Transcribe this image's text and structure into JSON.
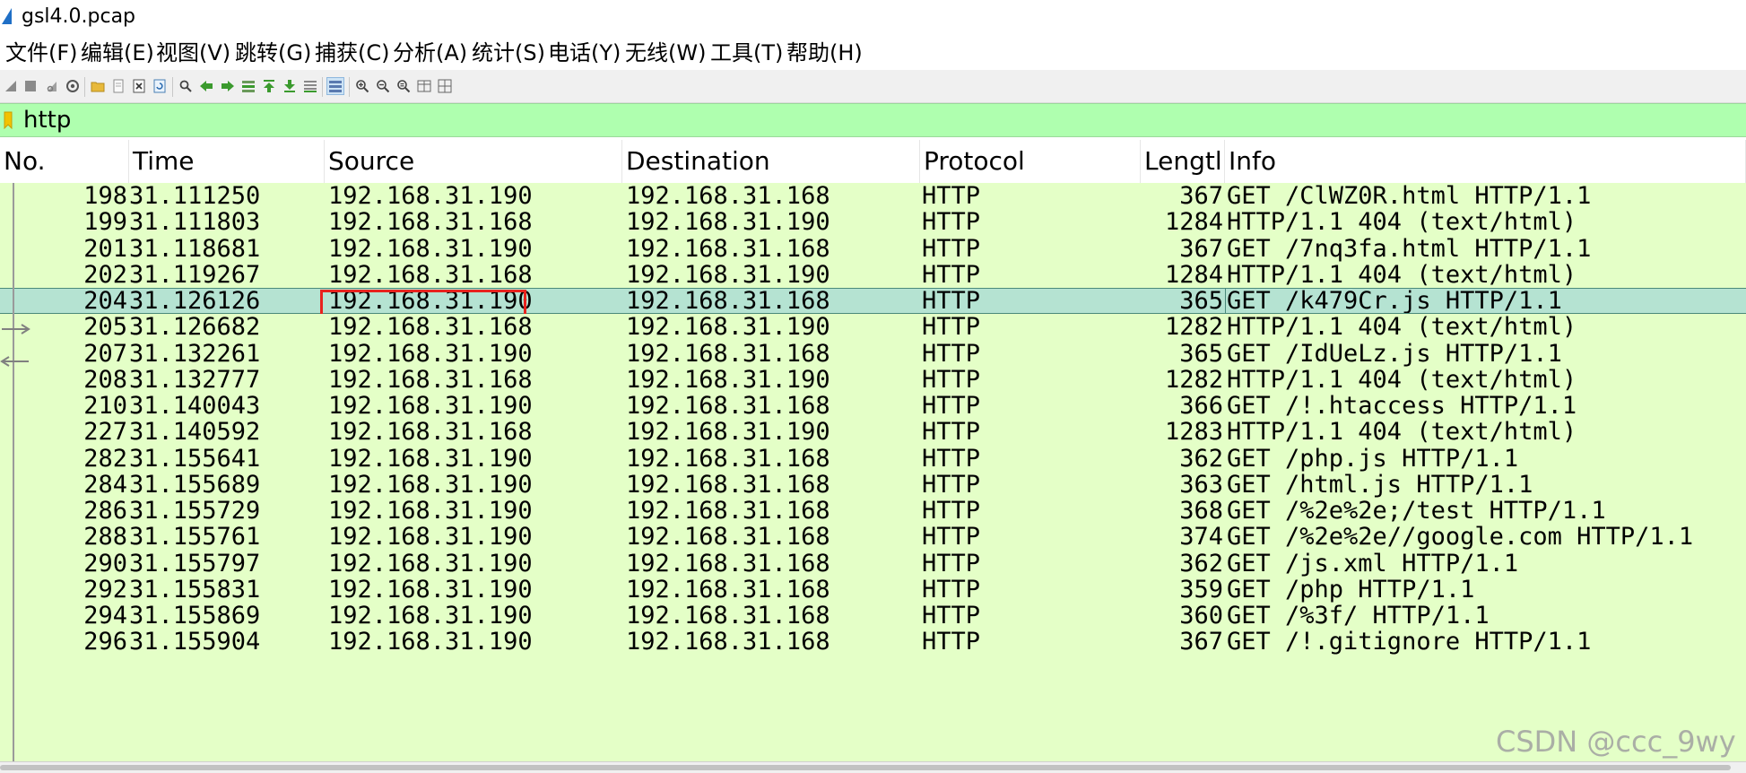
{
  "window": {
    "title": "gsl4.0.pcap",
    "icon": "wireshark-fin-icon"
  },
  "menu": [
    {
      "label": "文件(F)"
    },
    {
      "label": "编辑(E)"
    },
    {
      "label": "视图(V)"
    },
    {
      "label": "跳转(G)"
    },
    {
      "label": "捕获(C)"
    },
    {
      "label": "分析(A)"
    },
    {
      "label": "统计(S)"
    },
    {
      "label": "电话(Y)"
    },
    {
      "label": "无线(W)"
    },
    {
      "label": "工具(T)"
    },
    {
      "label": "帮助(H)"
    }
  ],
  "toolbar": [
    {
      "icon": "start-capture-icon"
    },
    {
      "icon": "stop-capture-icon"
    },
    {
      "icon": "restart-capture-icon"
    },
    {
      "icon": "capture-options-icon"
    },
    {
      "icon": "open-file-icon"
    },
    {
      "icon": "save-file-icon"
    },
    {
      "icon": "close-file-icon"
    },
    {
      "icon": "reload-file-icon"
    },
    {
      "icon": "find-packet-icon"
    },
    {
      "icon": "go-back-icon"
    },
    {
      "icon": "go-forward-icon"
    },
    {
      "icon": "go-to-packet-icon"
    },
    {
      "icon": "go-first-packet-icon"
    },
    {
      "icon": "go-last-packet-icon"
    },
    {
      "icon": "auto-scroll-icon"
    },
    {
      "icon": "colorize-icon"
    },
    {
      "icon": "zoom-in-icon"
    },
    {
      "icon": "zoom-out-icon"
    },
    {
      "icon": "normal-size-icon"
    },
    {
      "icon": "resize-columns-icon"
    },
    {
      "icon": "layout-icon"
    }
  ],
  "filter": {
    "value": "http",
    "bookmark_icon": "bookmark-icon",
    "background": "#afffaf"
  },
  "columns": [
    {
      "label": "No."
    },
    {
      "label": "Time"
    },
    {
      "label": "Source"
    },
    {
      "label": "Destination"
    },
    {
      "label": "Protocol"
    },
    {
      "label": "Lengtl"
    },
    {
      "label": "Info"
    }
  ],
  "row_color": "#e4ffc7",
  "selected_color": "#b5e3d2",
  "highlight_color": "#e8231e",
  "packets": [
    {
      "no": "198",
      "time": "31.111250",
      "src": "192.168.31.190",
      "dst": "192.168.31.168",
      "proto": "HTTP",
      "len": "367",
      "info": "GET /ClWZ0R.html HTTP/1.1"
    },
    {
      "no": "199",
      "time": "31.111803",
      "src": "192.168.31.168",
      "dst": "192.168.31.190",
      "proto": "HTTP",
      "len": "1284",
      "info": "HTTP/1.1 404   (text/html)"
    },
    {
      "no": "201",
      "time": "31.118681",
      "src": "192.168.31.190",
      "dst": "192.168.31.168",
      "proto": "HTTP",
      "len": "367",
      "info": "GET /7nq3fa.html HTTP/1.1"
    },
    {
      "no": "202",
      "time": "31.119267",
      "src": "192.168.31.168",
      "dst": "192.168.31.190",
      "proto": "HTTP",
      "len": "1284",
      "info": "HTTP/1.1 404   (text/html)"
    },
    {
      "no": "204",
      "time": "31.126126",
      "src": "192.168.31.190",
      "dst": "192.168.31.168",
      "proto": "HTTP",
      "len": "365",
      "info": "GET /k479Cr.js HTTP/1.1",
      "selected": true
    },
    {
      "no": "205",
      "time": "31.126682",
      "src": "192.168.31.168",
      "dst": "192.168.31.190",
      "proto": "HTTP",
      "len": "1282",
      "info": "HTTP/1.1 404   (text/html)"
    },
    {
      "no": "207",
      "time": "31.132261",
      "src": "192.168.31.190",
      "dst": "192.168.31.168",
      "proto": "HTTP",
      "len": "365",
      "info": "GET /IdUeLz.js HTTP/1.1"
    },
    {
      "no": "208",
      "time": "31.132777",
      "src": "192.168.31.168",
      "dst": "192.168.31.190",
      "proto": "HTTP",
      "len": "1282",
      "info": "HTTP/1.1 404   (text/html)"
    },
    {
      "no": "210",
      "time": "31.140043",
      "src": "192.168.31.190",
      "dst": "192.168.31.168",
      "proto": "HTTP",
      "len": "366",
      "info": "GET /!.htaccess HTTP/1.1"
    },
    {
      "no": "227",
      "time": "31.140592",
      "src": "192.168.31.168",
      "dst": "192.168.31.190",
      "proto": "HTTP",
      "len": "1283",
      "info": "HTTP/1.1 404   (text/html)"
    },
    {
      "no": "282",
      "time": "31.155641",
      "src": "192.168.31.190",
      "dst": "192.168.31.168",
      "proto": "HTTP",
      "len": "362",
      "info": "GET /php.js HTTP/1.1"
    },
    {
      "no": "284",
      "time": "31.155689",
      "src": "192.168.31.190",
      "dst": "192.168.31.168",
      "proto": "HTTP",
      "len": "363",
      "info": "GET /html.js HTTP/1.1"
    },
    {
      "no": "286",
      "time": "31.155729",
      "src": "192.168.31.190",
      "dst": "192.168.31.168",
      "proto": "HTTP",
      "len": "368",
      "info": "GET /%2e%2e;/test HTTP/1.1"
    },
    {
      "no": "288",
      "time": "31.155761",
      "src": "192.168.31.190",
      "dst": "192.168.31.168",
      "proto": "HTTP",
      "len": "374",
      "info": "GET /%2e%2e//google.com HTTP/1.1"
    },
    {
      "no": "290",
      "time": "31.155797",
      "src": "192.168.31.190",
      "dst": "192.168.31.168",
      "proto": "HTTP",
      "len": "362",
      "info": "GET /js.xml HTTP/1.1"
    },
    {
      "no": "292",
      "time": "31.155831",
      "src": "192.168.31.190",
      "dst": "192.168.31.168",
      "proto": "HTTP",
      "len": "359",
      "info": "GET /php HTTP/1.1"
    },
    {
      "no": "294",
      "time": "31.155869",
      "src": "192.168.31.190",
      "dst": "192.168.31.168",
      "proto": "HTTP",
      "len": "360",
      "info": "GET /%3f/ HTTP/1.1"
    },
    {
      "no": "296",
      "time": "31.155904",
      "src": "192.168.31.190",
      "dst": "192.168.31.168",
      "proto": "HTTP",
      "len": "367",
      "info": "GET /!.gitignore HTTP/1.1"
    }
  ],
  "watermark": "CSDN @ccc_9wy"
}
